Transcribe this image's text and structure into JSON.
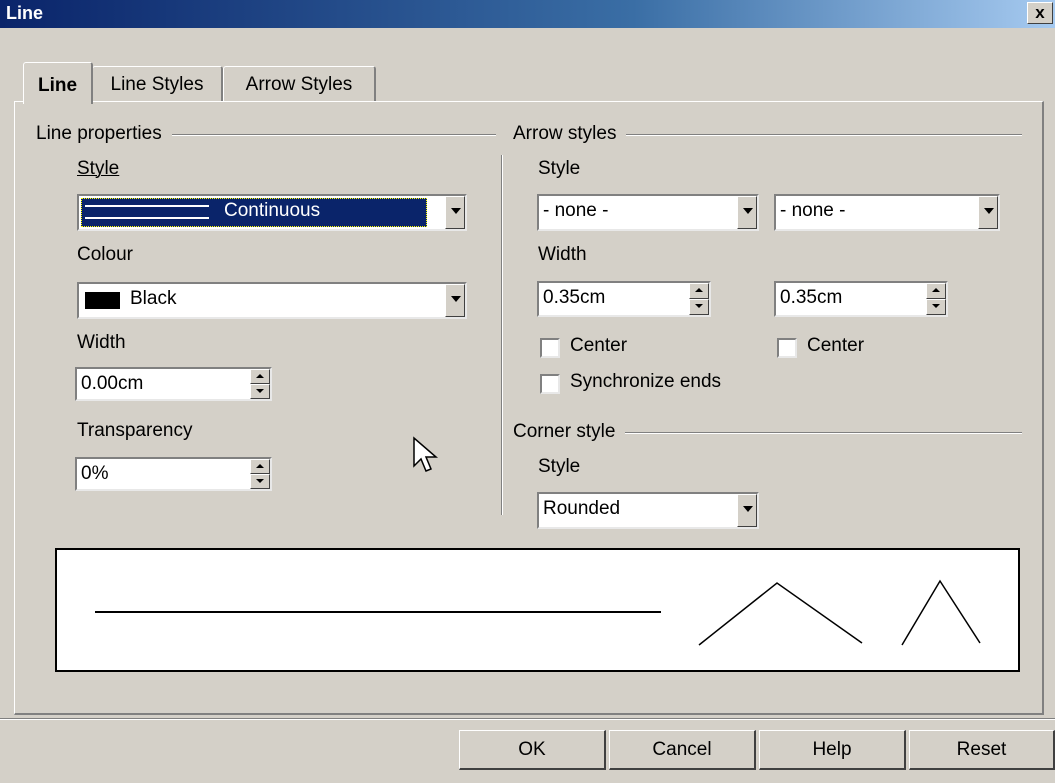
{
  "window": {
    "title": "Line",
    "close_symbol": "x"
  },
  "tabs": [
    {
      "label": "Line",
      "active": true
    },
    {
      "label": "Line Styles",
      "active": false
    },
    {
      "label": "Arrow Styles",
      "active": false
    }
  ],
  "line_properties": {
    "group_label": "Line properties",
    "style_label": "Style",
    "style_value": "Continuous",
    "colour_label": "Colour",
    "colour_value": "Black",
    "width_label": "Width",
    "width_value": "0.00cm",
    "transparency_label": "Transparency",
    "transparency_value": "0%"
  },
  "arrow_styles": {
    "group_label": "Arrow styles",
    "style_label": "Style",
    "start_style": "- none -",
    "end_style": "- none -",
    "width_label": "Width",
    "start_width": "0.35cm",
    "end_width": "0.35cm",
    "center_start_label": "Center",
    "center_end_label": "Center",
    "center_start_checked": false,
    "center_end_checked": false,
    "sync_label": "Synchronize ends",
    "sync_checked": false
  },
  "corner_style": {
    "group_label": "Corner style",
    "style_label": "Style",
    "style_value": "Rounded"
  },
  "buttons": {
    "ok": "OK",
    "cancel": "Cancel",
    "help": "Help",
    "reset": "Reset"
  },
  "colors": {
    "selection": "#0a246a",
    "face": "#d4d0c8",
    "swatch": "#000000"
  }
}
